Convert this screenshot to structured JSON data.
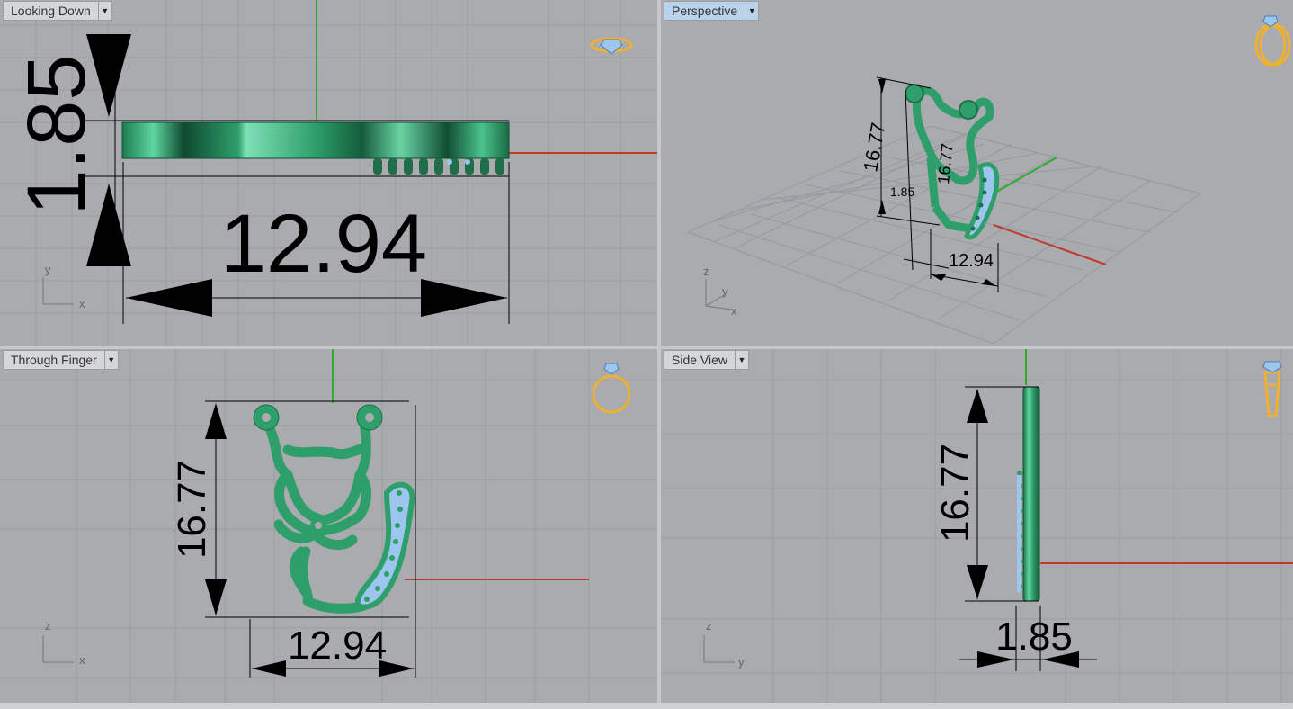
{
  "viewports": {
    "top": {
      "label": "Looking Down",
      "width_dim": "12.94",
      "thickness_dim": "1.85",
      "axes": {
        "v": "y",
        "h": "x"
      }
    },
    "persp": {
      "label": "Perspective",
      "height_dim": "16.77",
      "inner_dim": "16.77",
      "width_dim": "12.94",
      "thickness_dim": "1.85",
      "axes": {
        "v": "z",
        "d": "y",
        "h": "x"
      }
    },
    "front": {
      "label": "Through Finger",
      "height_dim": "16.77",
      "width_dim": "12.94",
      "axes": {
        "v": "z",
        "h": "x"
      }
    },
    "right": {
      "label": "Side View",
      "height_dim": "16.77",
      "thickness_dim": "1.85",
      "axes": {
        "v": "z",
        "h": "y"
      }
    }
  },
  "colors": {
    "viewport_bg": "#a9abae",
    "grid": "#9a9ca0",
    "model_green": "#2e9f6b",
    "model_dark": "#1f6e49",
    "gem_blue": "#9cc6ee",
    "axis_x": "#c0392b",
    "axis_y": "#2eaa2e",
    "ring_icon": "#f0b030"
  },
  "icons": [
    "ring-top-icon",
    "ring-perspective-icon",
    "ring-front-icon",
    "ring-side-icon",
    "dropdown-caret-icon"
  ]
}
